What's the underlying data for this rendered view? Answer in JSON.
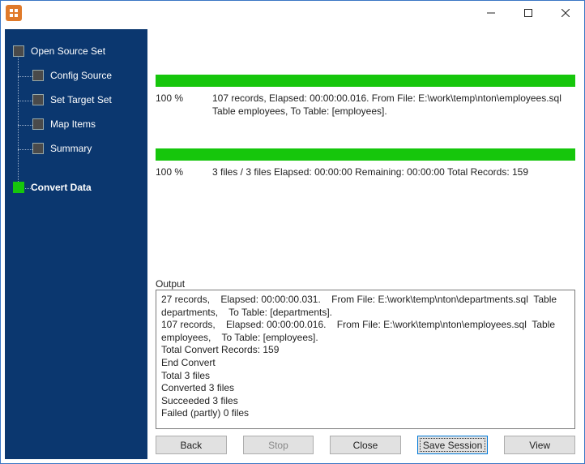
{
  "titlebar": {
    "title": ""
  },
  "sidebar": {
    "steps": [
      {
        "label": "Open Source Set",
        "level": "top",
        "current": false
      },
      {
        "label": "Config Source",
        "level": "sub",
        "current": false
      },
      {
        "label": "Set Target Set",
        "level": "sub",
        "current": false
      },
      {
        "label": "Map Items",
        "level": "sub",
        "current": false
      },
      {
        "label": "Summary",
        "level": "sub",
        "current": false
      },
      {
        "label": "Convert Data",
        "level": "top",
        "current": true
      }
    ]
  },
  "progress": {
    "task": {
      "percent": "100 %",
      "line1": "107 records,    Elapsed: 00:00:00.016.    From File: E:\\work\\temp\\nton\\employees.sql  Table employees,    To Table: [employees]."
    },
    "overall": {
      "percent": "100 %",
      "line1": "3 files / 3 files    Elapsed: 00:00:00    Remaining: 00:00:00    Total Records: 159"
    }
  },
  "output": {
    "label": "Output",
    "text": "27 records,    Elapsed: 00:00:00.031.    From File: E:\\work\\temp\\nton\\departments.sql  Table departments,    To Table: [departments].\n107 records,    Elapsed: 00:00:00.016.    From File: E:\\work\\temp\\nton\\employees.sql  Table employees,    To Table: [employees].\nTotal Convert Records: 159\nEnd Convert\nTotal 3 files\nConverted 3 files\nSucceeded 3 files\nFailed (partly) 0 files"
  },
  "buttons": {
    "back": "Back",
    "stop": "Stop",
    "close": "Close",
    "save_session": "Save Session",
    "view": "View"
  },
  "colors": {
    "brand_bg": "#0b376f",
    "accent_green": "#16c60c",
    "app_icon": "#e07a2a"
  }
}
